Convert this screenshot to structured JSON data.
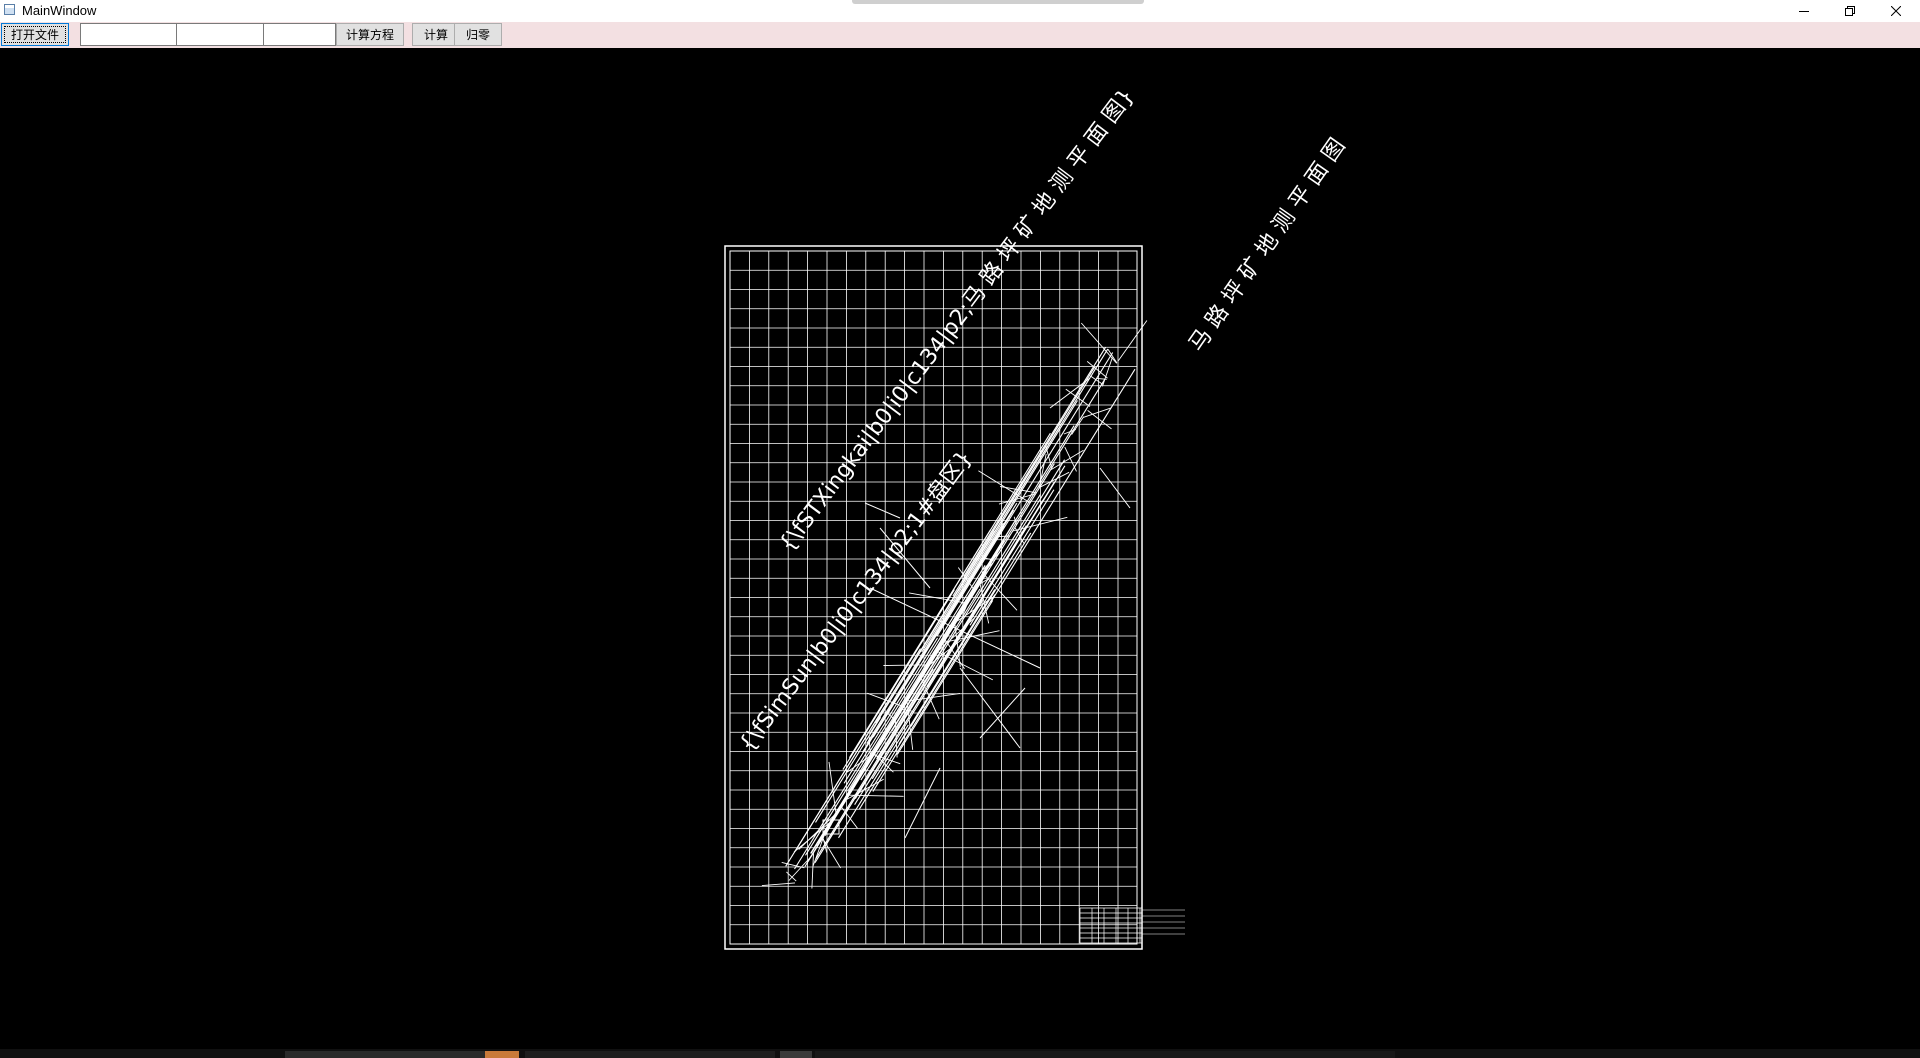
{
  "window": {
    "title": "MainWindow",
    "minimize_glyph": "─",
    "restore_glyph": "❐",
    "close_glyph": "✕"
  },
  "toolbar": {
    "open_file_label": "打开文件",
    "input1_value": "",
    "input2_value": "",
    "input3_value": "",
    "calc_equation_label": "计算方程",
    "calc2_label": "计算",
    "reset_label": "归零"
  },
  "drawing": {
    "title_text": "马 路 坪 矿 地 测 平 面 图",
    "diag_text_1": "{\\fSTXingkai|b0|i0|c134|p2;马 路 坪 矿 地 测 平 面 图}",
    "diag_text_2": "{\\fSimSun|b0|i0|c134|p2;1#盘区}",
    "colors": {
      "background": "#000000",
      "lines": "#ffffff"
    }
  },
  "icons": [
    "app-icon",
    "minimize-icon",
    "restore-icon",
    "close-icon"
  ]
}
